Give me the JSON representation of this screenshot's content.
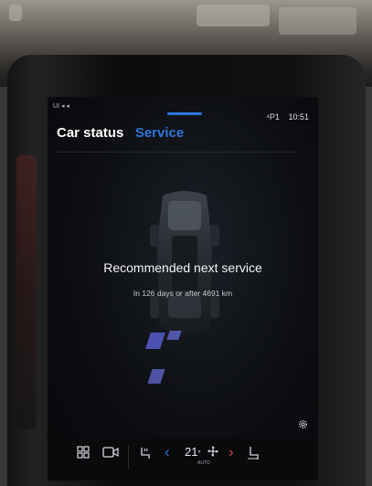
{
  "status_bar": {
    "left": "UI ◂ ◂",
    "network": "⁴P1",
    "time": "10:51"
  },
  "tabs": [
    {
      "label": "Car status",
      "active": true
    },
    {
      "label": "Service",
      "active": false
    }
  ],
  "service": {
    "headline": "Recommended next service",
    "detail": "In 126 days or after 4691 km"
  },
  "climate": {
    "temperature": "21",
    "unit": "°",
    "mode": "AUTO"
  },
  "icons": [
    "grid-icon",
    "camera-icon",
    "seat-heat-icon",
    "chevron-left-icon",
    "fan-icon",
    "chevron-right-icon",
    "seat-icon",
    "gear-icon"
  ],
  "colors": {
    "accent": "#2f74d8",
    "screen_bg": "#0c0e12",
    "text": "#f1f2f4"
  }
}
